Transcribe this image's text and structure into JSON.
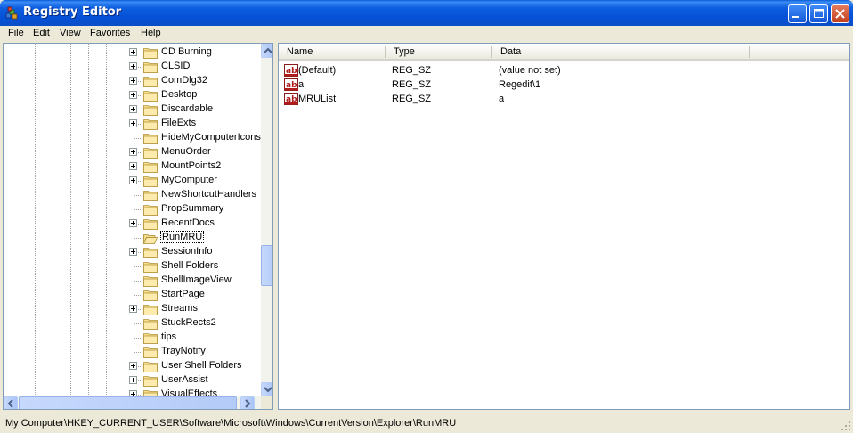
{
  "window": {
    "title": "Registry Editor"
  },
  "menu": [
    "File",
    "Edit",
    "View",
    "Favorites",
    "Help"
  ],
  "tree": {
    "items": [
      {
        "label": "CD Burning",
        "expandable": true
      },
      {
        "label": "CLSID",
        "expandable": true
      },
      {
        "label": "ComDlg32",
        "expandable": true
      },
      {
        "label": "Desktop",
        "expandable": true
      },
      {
        "label": "Discardable",
        "expandable": true
      },
      {
        "label": "FileExts",
        "expandable": true
      },
      {
        "label": "HideMyComputerIcons",
        "expandable": false
      },
      {
        "label": "MenuOrder",
        "expandable": true
      },
      {
        "label": "MountPoints2",
        "expandable": true
      },
      {
        "label": "MyComputer",
        "expandable": true
      },
      {
        "label": "NewShortcutHandlers",
        "expandable": false
      },
      {
        "label": "PropSummary",
        "expandable": false
      },
      {
        "label": "RecentDocs",
        "expandable": true
      },
      {
        "label": "RunMRU",
        "expandable": false,
        "selected": true
      },
      {
        "label": "SessionInfo",
        "expandable": true
      },
      {
        "label": "Shell Folders",
        "expandable": false
      },
      {
        "label": "ShellImageView",
        "expandable": false
      },
      {
        "label": "StartPage",
        "expandable": false
      },
      {
        "label": "Streams",
        "expandable": true
      },
      {
        "label": "StuckRects2",
        "expandable": false
      },
      {
        "label": "tips",
        "expandable": false
      },
      {
        "label": "TrayNotify",
        "expandable": false
      },
      {
        "label": "User Shell Folders",
        "expandable": true
      },
      {
        "label": "UserAssist",
        "expandable": true
      },
      {
        "label": "VisualEffects",
        "expandable": true
      }
    ]
  },
  "list": {
    "columns": [
      "Name",
      "Type",
      "Data"
    ],
    "rows": [
      {
        "name": "(Default)",
        "type": "REG_SZ",
        "data": "(value not set)",
        "icon": "string-value-icon"
      },
      {
        "name": "a",
        "type": "REG_SZ",
        "data": "Regedit\\1",
        "icon": "string-value-icon"
      },
      {
        "name": "MRUList",
        "type": "REG_SZ",
        "data": "a",
        "icon": "string-value-icon"
      }
    ]
  },
  "status": {
    "path": "My Computer\\HKEY_CURRENT_USER\\Software\\Microsoft\\Windows\\CurrentVersion\\Explorer\\RunMRU"
  },
  "colors": {
    "titlebar": "#0550d6",
    "close_button": "#c2401c",
    "chrome": "#ece9d8",
    "pane_border": "#7f9db9"
  }
}
